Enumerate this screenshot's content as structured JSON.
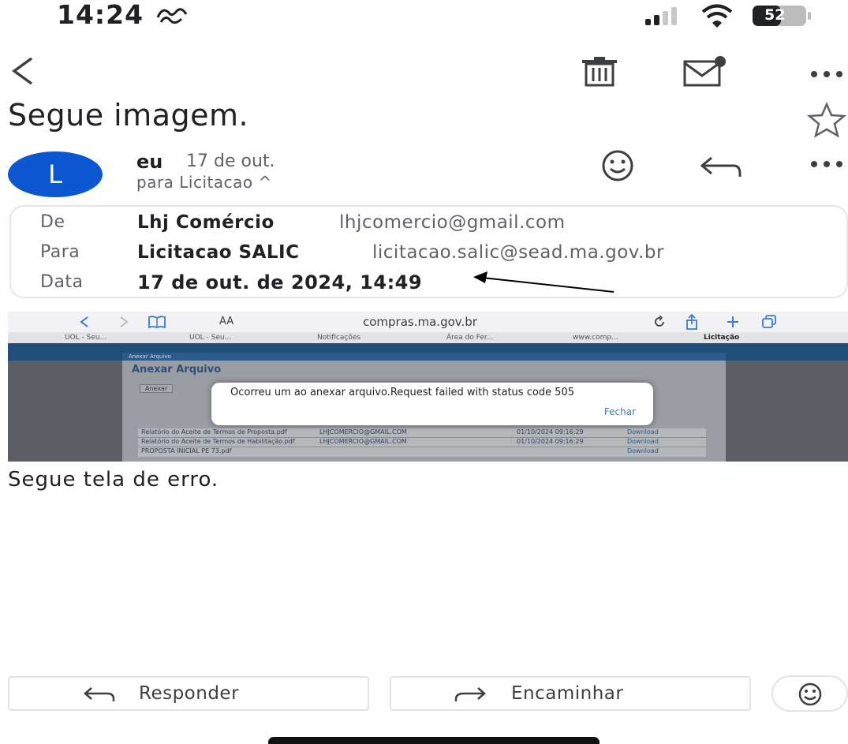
{
  "status_bar": {
    "time": "14:24",
    "battery": "52"
  },
  "toolbar": {
    "icons": [
      "back-icon",
      "trash-icon",
      "mark-unread-icon",
      "more-icon"
    ]
  },
  "email": {
    "subject": "Segue imagem.",
    "avatar_letter": "L",
    "sender_short": "eu",
    "sent_date_short": "17 de out.",
    "recipient_line": "para Licitacao ^",
    "details": {
      "from_label": "De",
      "from_name": "Lhj Comércio",
      "from_email": "lhjcomercio@gmail.com",
      "to_label": "Para",
      "to_name": "Licitacao SALIC",
      "to_email": "licitacao.salic@sead.ma.gov.br",
      "date_label": "Data",
      "date_value": "17 de out. de 2024, 14:49"
    },
    "body_text": "Segue tela de erro."
  },
  "embedded_screenshot": {
    "url": "compras.ma.gov.br",
    "text_size_label": "AA",
    "tabs": [
      "UOL - Seu...",
      "UOL - Seu...",
      "Notificações",
      "Área do Fer...",
      "www.comp...",
      "Licitação"
    ],
    "modal_title": "Anexar Arquivo",
    "modal_tab": "Anexar",
    "modal_header": "Anexar Arquivo",
    "dialog_message": "Ocorreu um ao anexar arquivo.Request failed with status code 505",
    "dialog_button": "Fechar",
    "table_rows": [
      [
        "Relatório do Aceite de Termos de Proposta.pdf",
        "LHJCOMERCIO@GMAIL.COM",
        "01/10/2024 09:16:29",
        "Download"
      ],
      [
        "Relatório do Aceite de Termos de Habilitação.pdf",
        "LHJCOMERCIO@GMAIL.COM",
        "01/10/2024 09:16:29",
        "Download"
      ],
      [
        "PROPOSTA INICIAL PE 73.pdf",
        "",
        "",
        "Download"
      ]
    ]
  },
  "actions": {
    "reply_label": "Responder",
    "forward_label": "Encaminhar"
  },
  "colors": {
    "avatar_bg": "#0b57d0",
    "text_primary": "#202124",
    "text_secondary": "#5f6368",
    "dialog_link": "#3a7bd5"
  }
}
